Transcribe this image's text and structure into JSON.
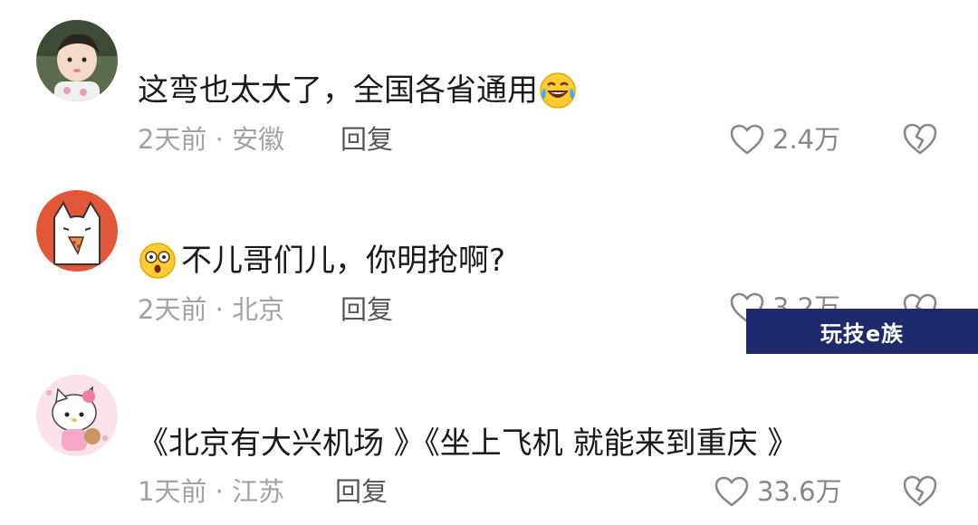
{
  "comments": [
    {
      "text": "这弯也太大了，全国各省通用",
      "trailing_emoji": "laughing-tears-emoji",
      "time_location": "2天前 · 安徽",
      "reply_label": "回复",
      "likes": "2.4万"
    },
    {
      "leading_emoji": "shocked-face-emoji",
      "text": "不儿哥们儿，你明抢啊?",
      "time_location": "2天前 · 北京",
      "reply_label": "回复",
      "likes": "3.2万"
    },
    {
      "text": "《北京有大兴机场 》《坐上飞机 就能来到重庆 》",
      "time_location": "1天前 · 江苏",
      "reply_label": "回复",
      "likes": "33.6万"
    }
  ],
  "watermark": {
    "text": "玩技e族"
  },
  "icons": {
    "like": "heart-outline-icon",
    "dislike": "broken-heart-icon"
  },
  "colors": {
    "text": "#1a1a1a",
    "meta": "#a3a3a3",
    "watermark_bg": "#1e2a6b"
  }
}
